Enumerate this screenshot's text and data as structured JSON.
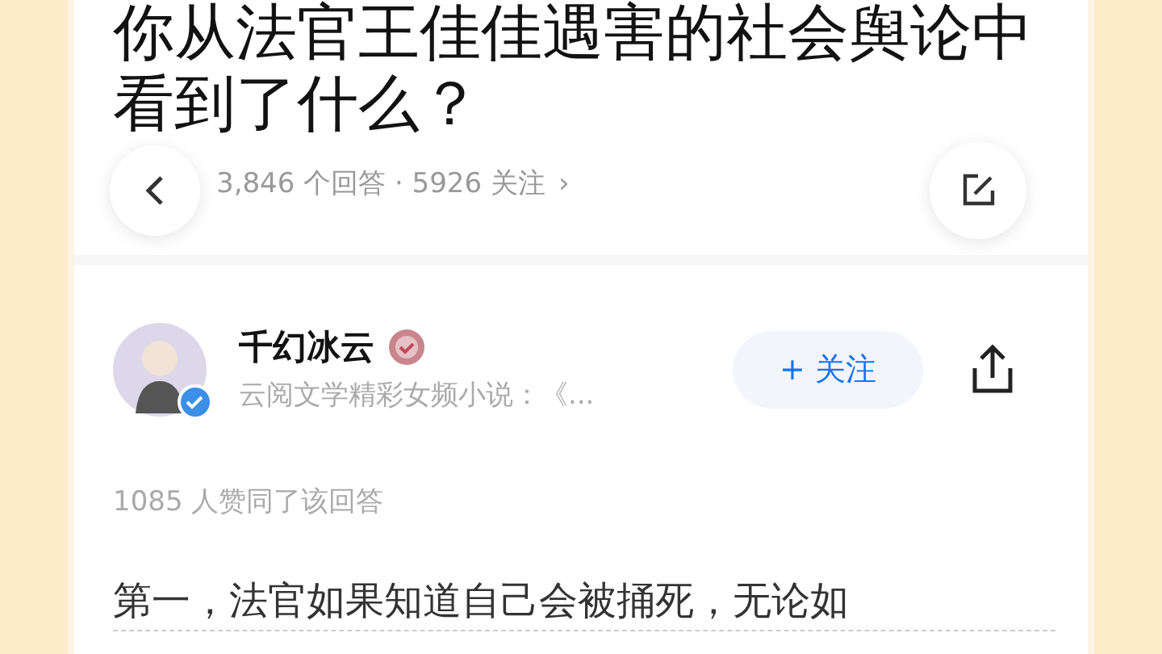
{
  "question": {
    "title": "你从法官王佳佳遇害的社会舆论中看到了什么？",
    "answers": "3,846 个回答 · 5926 关注",
    "chevron": "›"
  },
  "author": {
    "name": "千幻冰云",
    "bio": "云阅文学精彩女频小说：《...",
    "verified": true,
    "follow_label": "+ 关注"
  },
  "upvotes": "1085 人赞同了该回答",
  "body": "第一，法官如果知道自己会被捅死，无论如"
}
